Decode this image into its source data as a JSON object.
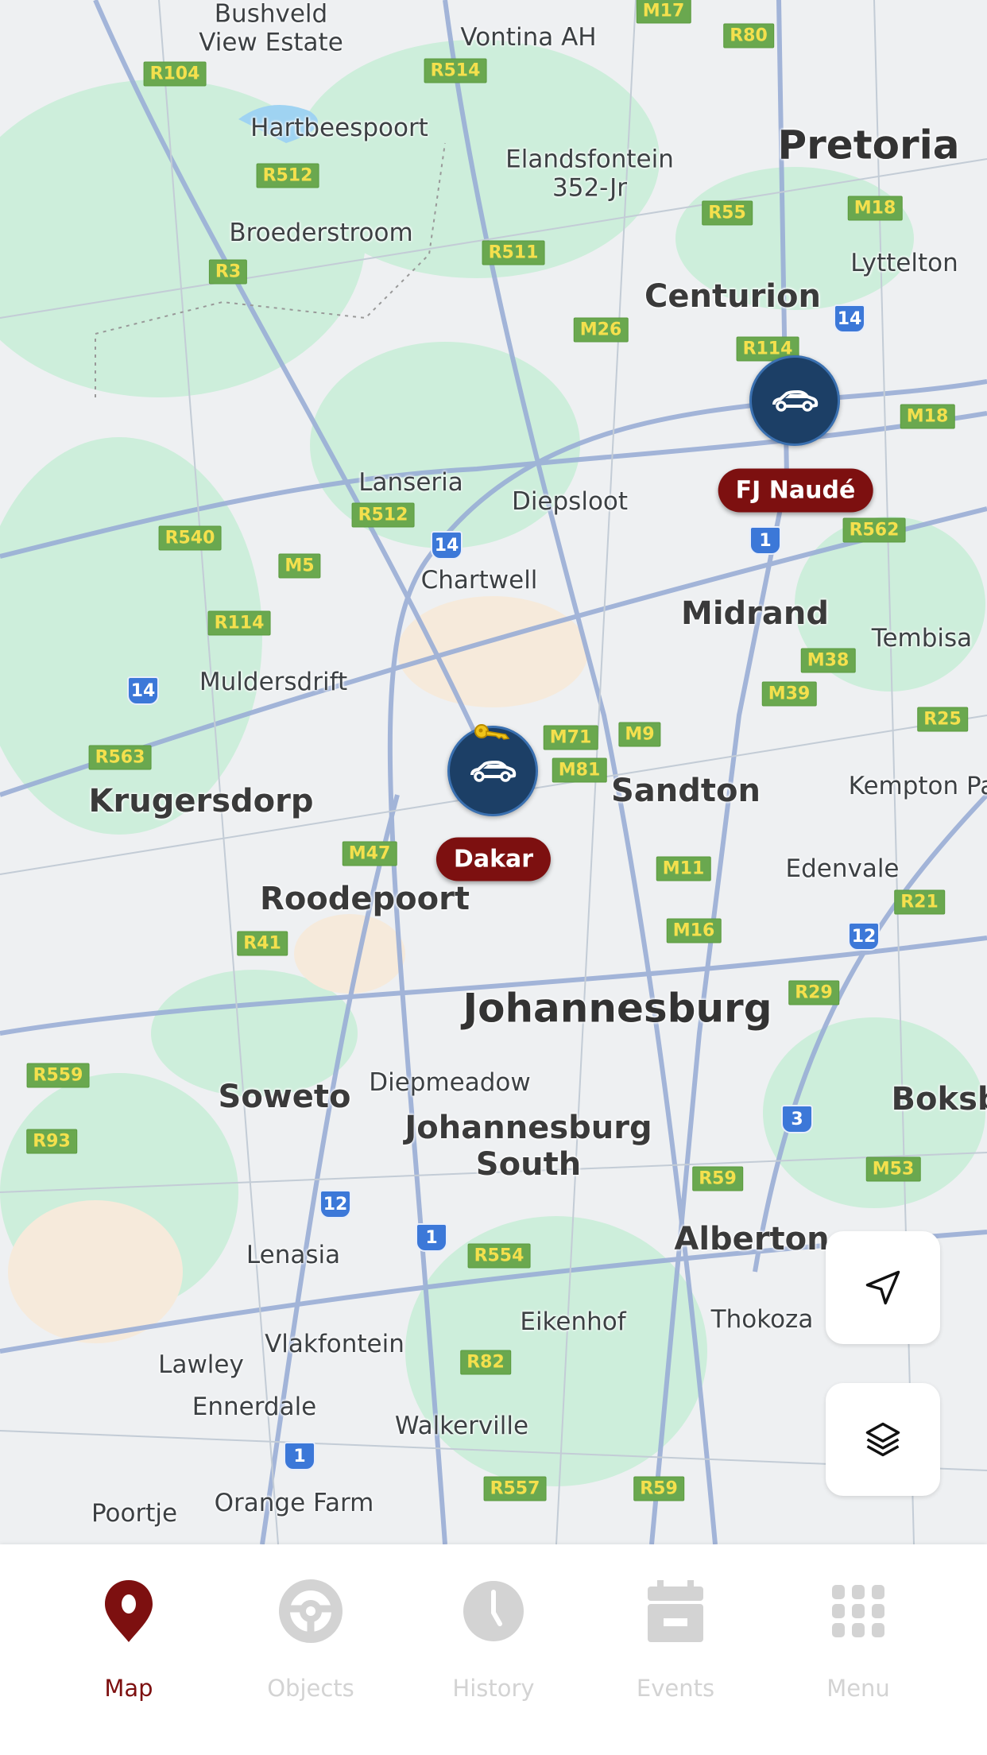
{
  "map": {
    "places": [
      "Bushveld\nView Estate",
      "Vontina AH",
      "Hartbeespoort",
      "Elandsfontein\n352-Jr",
      "Pretoria",
      "Broederstroom",
      "Lyttelton",
      "Centurion",
      "Lanseria",
      "Diepsloot",
      "Chartwell",
      "Midrand",
      "Tembisa",
      "Muldersdrift",
      "Krugersdorp",
      "Sandton",
      "Kempton Pa",
      "Edenvale",
      "Roodepoort",
      "Johannesburg",
      "Soweto",
      "Diepmeadow",
      "Johannesburg\nSouth",
      "Boksb",
      "Alberton",
      "Lenasia",
      "Eikenhof",
      "Thokoza",
      "Vlakfontein",
      "Lawley",
      "Ennerdale",
      "Walkerville",
      "Poortje",
      "Orange Farm"
    ],
    "road_shields": [
      "M17",
      "R80",
      "R104",
      "R514",
      "R512",
      "R55",
      "M18",
      "R3",
      "R511",
      "M26",
      "R114",
      "M18",
      "R512",
      "R540",
      "M5",
      "R562",
      "R114",
      "M38",
      "M39",
      "R25",
      "R563",
      "M71",
      "M9",
      "M81",
      "M47",
      "M11",
      "R21",
      "M16",
      "R41",
      "R29",
      "R559",
      "R93",
      "R59",
      "M53",
      "R554",
      "R82",
      "R557",
      "R59"
    ],
    "national_shields": [
      "14",
      "14",
      "1",
      "14",
      "12",
      "3",
      "12",
      "1",
      "1"
    ]
  },
  "vehicles": [
    {
      "name": "FJ Naudé",
      "icon": "car-icon",
      "has_key": false
    },
    {
      "name": "Dakar",
      "icon": "car-icon",
      "has_key": true
    }
  ],
  "controls": {
    "locate_icon": "navigation-arrow-icon",
    "layers_icon": "layers-icon"
  },
  "nav": {
    "items": [
      {
        "label": "Map",
        "icon": "map-pin-icon",
        "active": true
      },
      {
        "label": "Objects",
        "icon": "steering-wheel-icon",
        "active": false
      },
      {
        "label": "History",
        "icon": "clock-icon",
        "active": false
      },
      {
        "label": "Events",
        "icon": "calendar-icon",
        "active": false
      },
      {
        "label": "Menu",
        "icon": "grid-icon",
        "active": false
      }
    ]
  },
  "colors": {
    "accent": "#7d1010",
    "marker": "#1c3f66",
    "inactive": "#d3d3d3"
  }
}
